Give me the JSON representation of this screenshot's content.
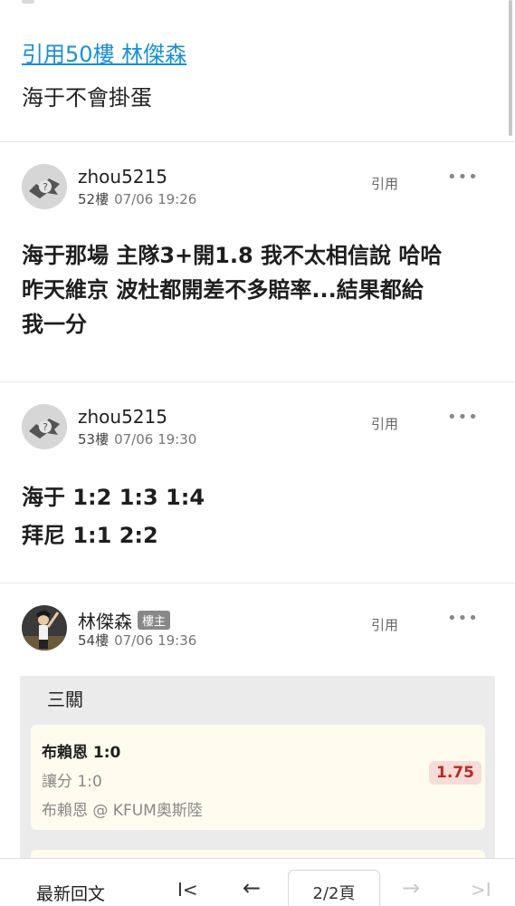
{
  "quote": {
    "link": "引用50樓 林傑森",
    "text": "海于不會掛蛋"
  },
  "posts": [
    {
      "user": "zhou5215",
      "floor": "52樓",
      "time": "07/06 19:26",
      "quote_label": "引用",
      "more": "•••",
      "body": [
        "海于那場 主隊3+開1.8 我不太相信說 哈哈",
        "昨天維京 波杜都開差不多賠率...結果都給",
        "我一分"
      ]
    },
    {
      "user": "zhou5215",
      "floor": "53樓",
      "time": "07/06 19:30",
      "quote_label": "引用",
      "more": "•••",
      "body": [
        "海于 1:2 1:3 1:4",
        "拜尼 1:1 2:2"
      ]
    },
    {
      "user": "林傑森",
      "badge": "樓主",
      "floor": "54樓",
      "time": "07/06 19:36",
      "quote_label": "引用",
      "more": "•••"
    }
  ],
  "bet_card": {
    "title": "三關",
    "item": {
      "match": "布賴恩 1:0",
      "market": "讓分 1:0",
      "odds": "1.75",
      "event": "布賴恩 @ KFUM奧斯陸"
    }
  },
  "bottom_bar": {
    "latest": "最新回文",
    "first": "I<",
    "prev": "←",
    "page": "2/2頁",
    "next": "→",
    "last": ">I"
  },
  "colors": {
    "link": "#1b8fd6",
    "odds": "#b62b25",
    "odds_bg": "#f7dcd8",
    "bet_item_bg": "#fffbef"
  },
  "icons": [
    "default-avatar-icon",
    "user-photo-avatar",
    "more-options-icon",
    "first-page-icon",
    "prev-page-icon",
    "next-page-icon",
    "last-page-icon"
  ]
}
